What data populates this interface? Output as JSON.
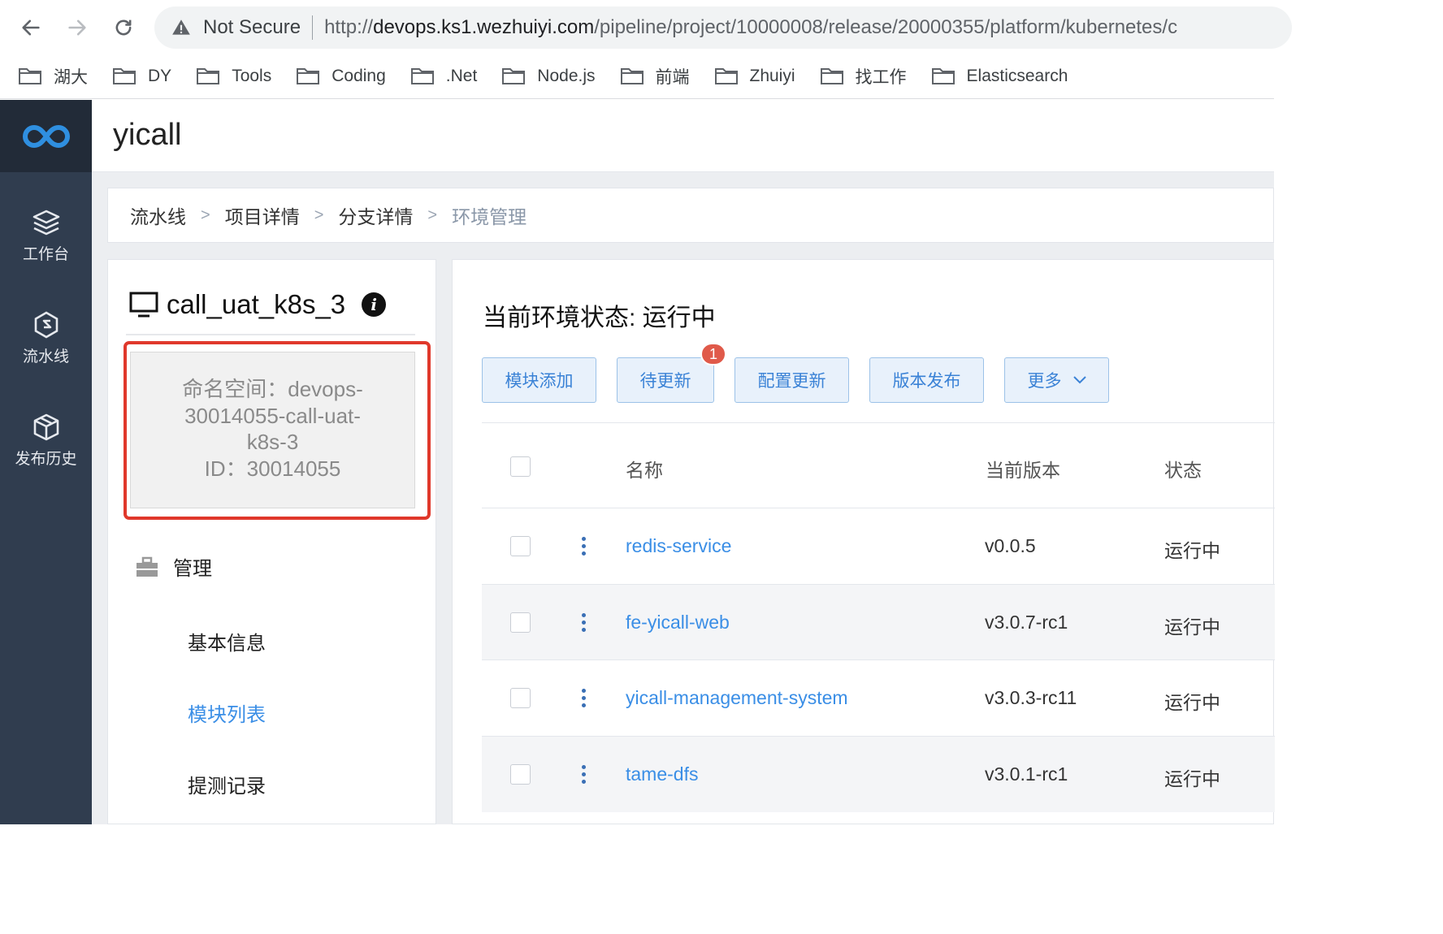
{
  "browser": {
    "security_label": "Not Secure",
    "url_prefix": "http://",
    "url_host": "devops.ks1.wezhuiyi.com",
    "url_path": "/pipeline/project/10000008/release/20000355/platform/kubernetes/c",
    "bookmarks": [
      "湖大",
      "DY",
      "Tools",
      "Coding",
      ".Net",
      "Node.js",
      "前端",
      "Zhuiyi",
      "找工作",
      "Elasticsearch"
    ]
  },
  "app": {
    "title": "yicall",
    "sidebar": [
      {
        "label": "工作台",
        "icon": "layers-icon"
      },
      {
        "label": "流水线",
        "icon": "hexagon-s-icon"
      },
      {
        "label": "发布历史",
        "icon": "box-icon"
      }
    ]
  },
  "breadcrumb": [
    "流水线",
    "项目详情",
    "分支详情",
    "环境管理"
  ],
  "env": {
    "name": "call_uat_k8s_3",
    "namespace_lines": [
      "命名空间：devops-",
      "30014055-call-uat-",
      "k8s-3",
      "ID：30014055"
    ],
    "menu_group": "管理",
    "menu_items": [
      "基本信息",
      "模块列表",
      "提测记录"
    ],
    "active_item": "模块列表"
  },
  "main": {
    "status_title": "当前环境状态: 运行中",
    "buttons": {
      "add_module": "模块添加",
      "pending_update": "待更新",
      "pending_count": "1",
      "config_update": "配置更新",
      "version_release": "版本发布",
      "more": "更多"
    },
    "table": {
      "headers": {
        "name": "名称",
        "version": "当前版本",
        "status": "状态"
      },
      "rows": [
        {
          "name": "redis-service",
          "version": "v0.0.5",
          "status": "运行中"
        },
        {
          "name": "fe-yicall-web",
          "version": "v3.0.7-rc1",
          "status": "运行中"
        },
        {
          "name": "yicall-management-system",
          "version": "v3.0.3-rc11",
          "status": "运行中"
        },
        {
          "name": "tame-dfs",
          "version": "v3.0.1-rc1",
          "status": "运行中"
        }
      ]
    }
  },
  "colors": {
    "accent": "#3a8ee6",
    "sidebar": "#303d4f",
    "highlight": "#e0382b"
  }
}
